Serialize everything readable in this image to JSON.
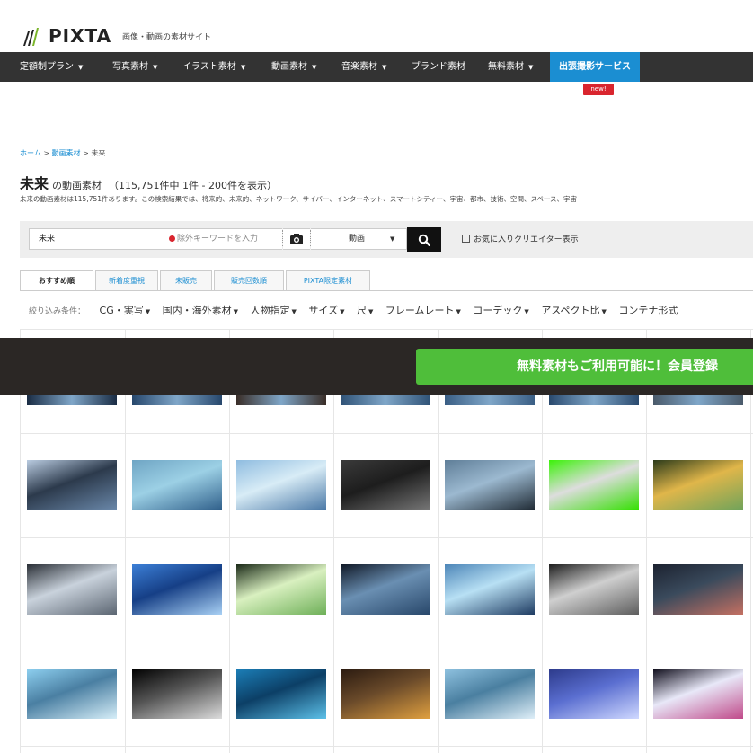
{
  "header": {
    "logo_text": "PIXTA",
    "tagline": "画像・動画の素材サイト"
  },
  "nav": {
    "items": [
      {
        "label": "定額制プラン",
        "caret": "▼"
      },
      {
        "label": "写真素材",
        "caret": "▼"
      },
      {
        "label": "イラスト素材",
        "caret": "▼"
      },
      {
        "label": "動画素材",
        "caret": "▼"
      },
      {
        "label": "音楽素材",
        "caret": "▼"
      },
      {
        "label": "ブランド素材",
        "caret": ""
      },
      {
        "label": "無料素材",
        "caret": "▼"
      },
      {
        "label": "出張撮影サービス",
        "caret": ""
      }
    ],
    "new_badge": "new!"
  },
  "breadcrumb": {
    "home": "ホーム",
    "sep1": ">",
    "category": "動画素材",
    "sep2": ">",
    "current": "未来"
  },
  "result": {
    "keyword": "未来",
    "suffix": "の動画素材",
    "count_text": "（115,751件中 1件 - 200件を表示）",
    "description": "未来の動画素材は115,751件あります。この検索結果では、将来的、未来的、ネットワーク、サイバー、インターネット、スマートシティー、宇宙、都市、技術、空間、スペース、宇宙"
  },
  "search": {
    "value": "未来",
    "exclude_placeholder": "除外キーワードを入力",
    "type_value": "動画",
    "type_caret": "▼",
    "fav_label": "お気に入りクリエイター表示"
  },
  "tabs": [
    "おすすめ順",
    "新着度重視",
    "未販売",
    "販売回数順",
    "PIXTA限定素材"
  ],
  "filters": {
    "label": "絞り込み条件：",
    "items": [
      {
        "label": "CG・実写",
        "caret": "▼"
      },
      {
        "label": "国内・海外素材",
        "caret": "▼"
      },
      {
        "label": "人物指定",
        "caret": "▼"
      },
      {
        "label": "サイズ",
        "caret": "▼"
      },
      {
        "label": "尺",
        "caret": "▼"
      },
      {
        "label": "フレームレート",
        "caret": "▼"
      },
      {
        "label": "コーデック",
        "caret": "▼"
      },
      {
        "label": "アスペクト比",
        "caret": "▼"
      },
      {
        "label": "コンテナ形式",
        "caret": ""
      }
    ]
  },
  "banner": {
    "text": "無料素材もご利用可能に！会員登録"
  },
  "colors": {
    "nav_bg": "#333333",
    "accent_blue": "#1b8ed2",
    "badge_red": "#d9252e",
    "banner_bg": "#2b2725",
    "banner_btn": "#4fbe3a"
  },
  "thumbnails": [
    {
      "row": 1,
      "col": 1,
      "subject": "wind turbines with person silhouette",
      "colors": [
        "#b9cbe0",
        "#6a88aa",
        "#2c3a4c"
      ]
    },
    {
      "row": 1,
      "col": 2,
      "subject": "digital city",
      "colors": [
        "#6fa5c4",
        "#2f5f8a",
        "#9cd0e5"
      ]
    },
    {
      "row": 1,
      "col": 3,
      "subject": "digital city",
      "colors": [
        "#8fbce0",
        "#4a78a6",
        "#d8ecf6"
      ]
    },
    {
      "row": 1,
      "col": 4,
      "subject": "car interior",
      "colors": [
        "#3a3a3a",
        "#777777",
        "#1d1d1d"
      ]
    },
    {
      "row": 1,
      "col": 5,
      "subject": "car dashboard",
      "colors": [
        "#5f7e98",
        "#1f2a34",
        "#9cb9d0"
      ]
    },
    {
      "row": 1,
      "col": 6,
      "subject": "astronaut green screen",
      "colors": [
        "#3cf20a",
        "#33e000",
        "#dddddd"
      ]
    },
    {
      "row": 1,
      "col": 7,
      "subject": "cyber light tunnel",
      "colors": [
        "#2c3b1a",
        "#6fa35a",
        "#e0b64a"
      ]
    },
    {
      "row": 2,
      "col": 1,
      "subject": "futuristic room",
      "colors": [
        "#2a2f36",
        "#5c6672",
        "#c9d2dc"
      ]
    },
    {
      "row": 2,
      "col": 2,
      "subject": "digital blue city",
      "colors": [
        "#3c7fd6",
        "#a8d0f4",
        "#163f86"
      ]
    },
    {
      "row": 2,
      "col": 3,
      "subject": "green data stream",
      "colors": [
        "#1b2a18",
        "#6fb059",
        "#d9f0c0"
      ]
    },
    {
      "row": 2,
      "col": 4,
      "subject": "night office",
      "colors": [
        "#101826",
        "#28476a",
        "#6a8fb2"
      ]
    },
    {
      "row": 2,
      "col": 5,
      "subject": "city network",
      "colors": [
        "#4d86b8",
        "#1f3c62",
        "#b8e0f4"
      ]
    },
    {
      "row": 2,
      "col": 6,
      "subject": "dark corridor",
      "colors": [
        "#1e1e1e",
        "#5e5e5e",
        "#cfcfcf"
      ]
    },
    {
      "row": 2,
      "col": 7,
      "subject": "silhouette with moon",
      "colors": [
        "#1c2230",
        "#c47062",
        "#3a4a5c"
      ]
    },
    {
      "row": 3,
      "col": 1,
      "subject": "city skyline light",
      "colors": [
        "#8ed0f0",
        "#d6eef8",
        "#4a7fa2"
      ]
    },
    {
      "row": 3,
      "col": 2,
      "subject": "humanoid robot",
      "colors": [
        "#000000",
        "#dcdcdc",
        "#555555"
      ]
    },
    {
      "row": 3,
      "col": 3,
      "subject": "highway interchange",
      "colors": [
        "#1c7fb8",
        "#5cc0e8",
        "#0c3f66"
      ]
    },
    {
      "row": 3,
      "col": 4,
      "subject": "city traffic night",
      "colors": [
        "#2a1a10",
        "#e0a040",
        "#6a4a2a"
      ]
    },
    {
      "row": 3,
      "col": 5,
      "subject": "city aerial",
      "colors": [
        "#8fc2e0",
        "#dfeff8",
        "#4a7fa0"
      ]
    },
    {
      "row": 3,
      "col": 6,
      "subject": "light speed tunnel",
      "colors": [
        "#2c3a8a",
        "#cfd8ff",
        "#5a6ed0"
      ]
    },
    {
      "row": 3,
      "col": 7,
      "subject": "space warp",
      "colors": [
        "#0c0a18",
        "#c04a8a",
        "#e8e8f8"
      ]
    }
  ],
  "partial_row_colors": [
    "#1a2c44",
    "#27476c",
    "#3a2e28",
    "#2f5276",
    "#3a5e84",
    "#2a4a6e",
    "#4a5a6a"
  ]
}
